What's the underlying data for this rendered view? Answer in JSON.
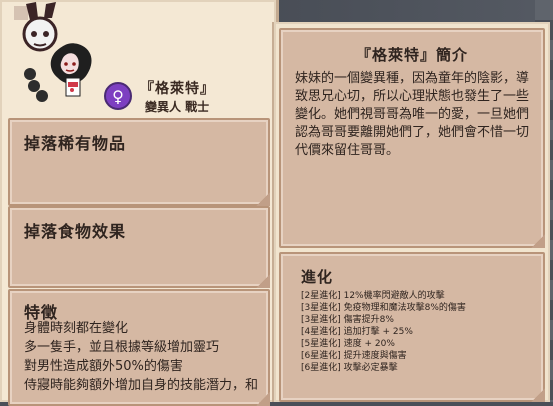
{
  "character": {
    "name": "『格萊特』",
    "tags": "變異人  戰士",
    "gender_symbol": "♀"
  },
  "left": {
    "rare_drops_title": "掉落稀有物品",
    "food_effect_title": "掉落食物效果",
    "traits_title": "特徵",
    "traits_lines": [
      "身體時刻都在變化",
      "多一隻手，並且根據等級增加靈巧",
      "對男性造成額外50%的傷害",
      "侍寢時能夠額外增加自身的技能潛力，和"
    ]
  },
  "bio": {
    "title": "『格萊特』簡介",
    "text": "妹妹的一個變異種，因為童年的陰影，導致思兄心切，所以心理狀態也發生了一些變化。她們視哥哥為唯一的愛，一旦她們認為哥哥要離開她們了，她們會不惜一切代價來留住哥哥。"
  },
  "evolution": {
    "title": "進化",
    "lines": [
      "[2星進化] 12%機率閃避敵人的攻擊",
      "[3星進化] 免疫物理和魔法攻擊8%的傷害",
      "[3星進化] 傷害提升8%",
      "[4星進化] 追加打擊 + 25%",
      "[5星進化] 速度 + 20%",
      "[6星進化] 提升速度與傷害",
      "[6星進化] 攻擊必定暴擊"
    ]
  }
}
